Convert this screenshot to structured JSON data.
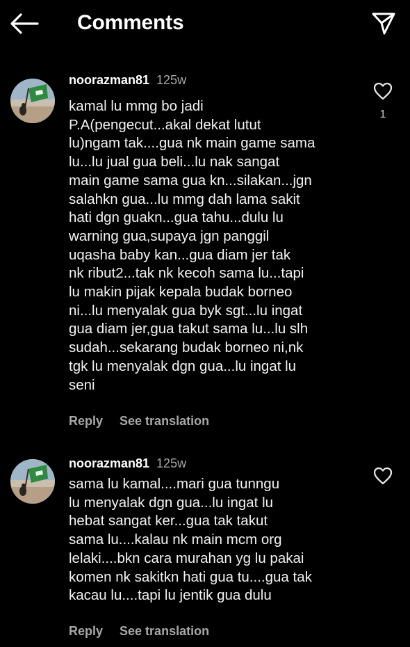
{
  "header": {
    "title": "Comments",
    "back_icon": "arrow-left-icon",
    "send_icon": "paper-plane-icon"
  },
  "comments": [
    {
      "username": "noorazman81",
      "time": "125w",
      "text": "kamal lu mmg bo jadi\nP.A(pengecut...akal dekat lutut\nlu)ngam tak....gua nk main game sama\nlu...lu jual gua beli...lu nak sangat\nmain game sama gua kn...silakan...jgn\nsalahkn gua...lu mmg dah lama sakit\nhati dgn guakn...gua tahu...dulu lu\nwarning gua,supaya jgn panggil\nuqasha baby kan...gua diam jer tak\nnk ribut2...tak nk kecoh sama lu...tapi\nlu makin pijak kepala budak borneo\nni...lu menyalak gua byk sgt...lu ingat\ngua diam jer,gua takut sama lu...lu slh\nsudah...sekarang budak borneo ni,nk\ntgk lu menyalak dgn gua...lu ingat lu\nseni",
      "reply_label": "Reply",
      "translate_label": "See translation",
      "like_count": "1"
    },
    {
      "username": "noorazman81",
      "time": "125w",
      "text": "sama lu kamal....mari gua tunngu\nlu menyalak dgn gua...lu ingat lu\nhebat sangat ker...gua tak takut\nsama lu....kalau nk main mcm org\nlelaki....bkn cara murahan yg lu pakai\nkomen nk sakitkn hati gua tu....gua tak\nkacau lu....tapi lu jentik gua dulu",
      "reply_label": "Reply",
      "translate_label": "See translation"
    }
  ],
  "colors": {
    "background": "#000000",
    "text": "#ffffff",
    "secondary_text": "#a8a8a8"
  }
}
